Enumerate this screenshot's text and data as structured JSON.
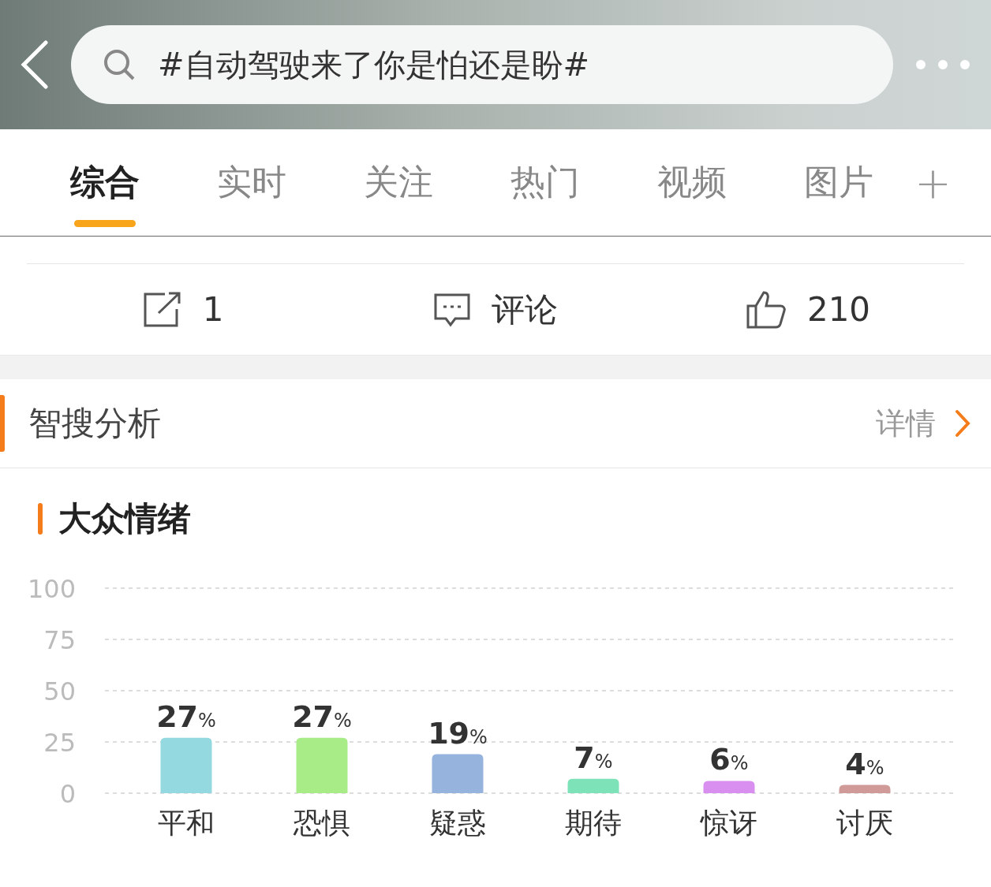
{
  "search": {
    "value": "#自动驾驶来了你是怕还是盼#"
  },
  "tabs": [
    {
      "label": "综合",
      "selected": true
    },
    {
      "label": "实时",
      "selected": false
    },
    {
      "label": "关注",
      "selected": false
    },
    {
      "label": "热门",
      "selected": false
    },
    {
      "label": "视频",
      "selected": false
    },
    {
      "label": "图片",
      "selected": false
    }
  ],
  "add_tab": "+",
  "actions": [
    {
      "kind": "share",
      "label": "1"
    },
    {
      "kind": "comment",
      "label": "评论"
    },
    {
      "kind": "like",
      "label": "210"
    }
  ],
  "section": {
    "title": "智搜分析",
    "link": "详情"
  },
  "emotion_chart": {
    "title": "大众情绪",
    "chart_data": {
      "type": "bar",
      "categories": [
        "平和",
        "恐惧",
        "疑惑",
        "期待",
        "惊讶",
        "讨厌"
      ],
      "series": [
        {
          "values": [
            27,
            27,
            19,
            7,
            6,
            4
          ]
        }
      ],
      "grid": true,
      "ylim": [
        0,
        100
      ],
      "yticks": [
        0,
        25,
        50,
        75,
        100
      ],
      "value_labels": [
        "27%",
        "27%",
        "19%",
        "7%",
        "6%",
        "4%"
      ]
    }
  }
}
